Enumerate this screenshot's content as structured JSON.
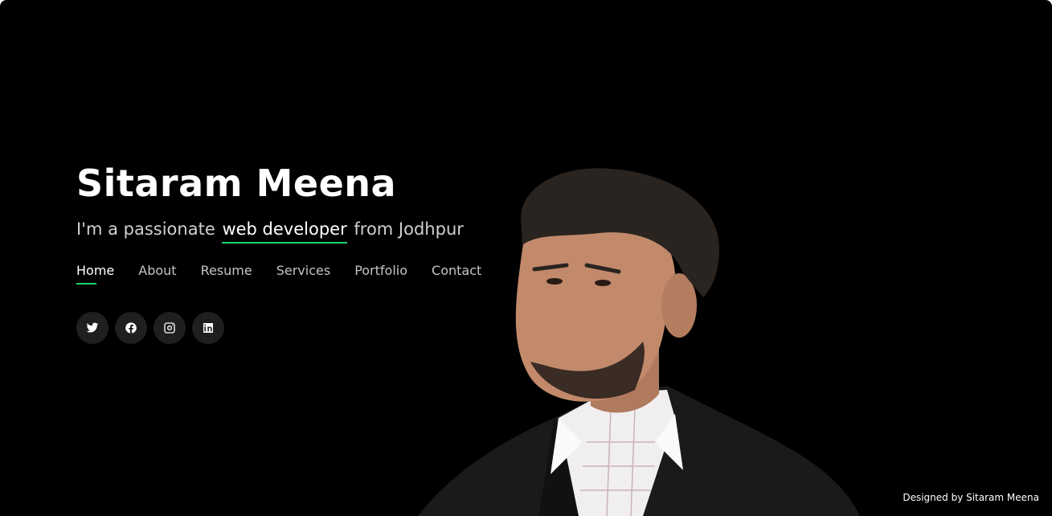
{
  "hero": {
    "name": "Sitaram Meena",
    "tagline_prefix": "I'm a passionate",
    "tagline_typed": "web developer",
    "tagline_suffix": "from Jodhpur"
  },
  "nav": {
    "items": [
      {
        "label": "Home",
        "active": true
      },
      {
        "label": "About"
      },
      {
        "label": "Resume"
      },
      {
        "label": "Services"
      },
      {
        "label": "Portfolio"
      },
      {
        "label": "Contact"
      }
    ]
  },
  "social": {
    "icons": [
      "twitter-icon",
      "facebook-icon",
      "instagram-icon",
      "linkedin-icon"
    ]
  },
  "footer": {
    "credit": "Designed by Sitaram Meena"
  },
  "colors": {
    "background": "#000000",
    "accent": "#18d26e",
    "text": "#ffffff",
    "muted_text": "#c4c4c4",
    "social_button_bg": "#1f1f1f"
  }
}
